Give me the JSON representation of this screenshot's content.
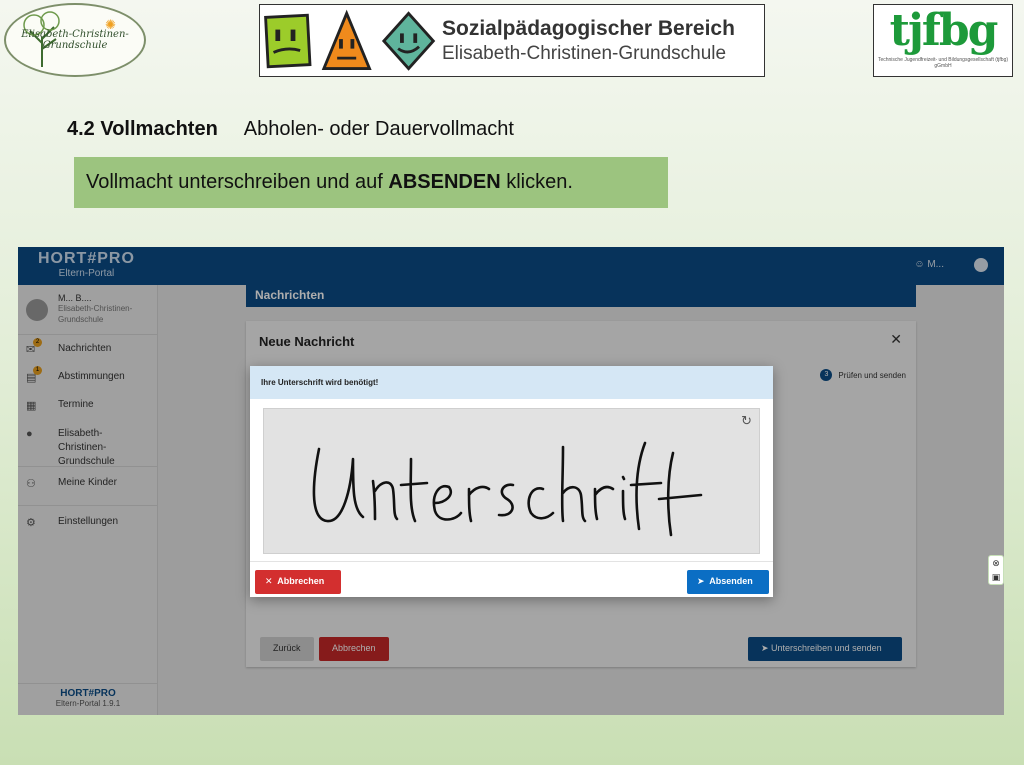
{
  "slide": {
    "logo_left_text": "Elisabeth-Christinen-Grundschule",
    "banner_line1": "Sozialpädagogischer Bereich",
    "banner_line2": "Elisabeth-Christinen-Grundschule",
    "logo_right_text": "tjfbg",
    "logo_right_small": "Technische Jugendfreizeit- und Bildungsgesellschaft (tjfbg) gGmbH",
    "heading_number": "4.2 Vollmachten",
    "heading_sub": "Abholen- oder Dauervollmacht",
    "instruction_pre": "Vollmacht unterschreiben und auf ",
    "instruction_bold": "ABSENDEN",
    "instruction_post": " klicken."
  },
  "app": {
    "brand_title": "HORT#PRO",
    "brand_sub": "Eltern-Portal",
    "topbar_user": "M...",
    "profile_name": "M... B....",
    "profile_school": "Elisabeth-Christinen-Grundschule",
    "nav": [
      {
        "label": "Nachrichten",
        "icon": "mail-icon",
        "badge": "2"
      },
      {
        "label": "Abstimmungen",
        "icon": "poll-icon",
        "badge": "1"
      },
      {
        "label": "Termine",
        "icon": "calendar-icon",
        "badge": ""
      },
      {
        "label": "Elisabeth-Christinen-Grundschule",
        "icon": "info-icon",
        "badge": ""
      },
      {
        "label": "Meine Kinder",
        "icon": "people-icon",
        "badge": ""
      },
      {
        "label": "Einstellungen",
        "icon": "gear-icon",
        "badge": ""
      }
    ],
    "footer_brand": "HORT#PRO",
    "footer_version": "Eltern-Portal 1.9.1",
    "page_header": "Nachrichten",
    "card_title": "Neue Nachricht",
    "step_number": "3",
    "step_label": "Prüfen und senden",
    "btn_back": "Zurück",
    "btn_cancel_card": "Abbrechen",
    "btn_sign_send": "Unterschreiben und senden"
  },
  "dialog": {
    "title": "Ihre Unterschrift wird benötigt!",
    "signature_text": "Unterschrift",
    "btn_cancel": "Abbrechen",
    "btn_send": "Absenden"
  },
  "colors": {
    "appbar": "#0b4c86",
    "cancel_red": "#d32f2f",
    "send_blue": "#0b6ec4",
    "instruction_green": "#9cc47f"
  }
}
